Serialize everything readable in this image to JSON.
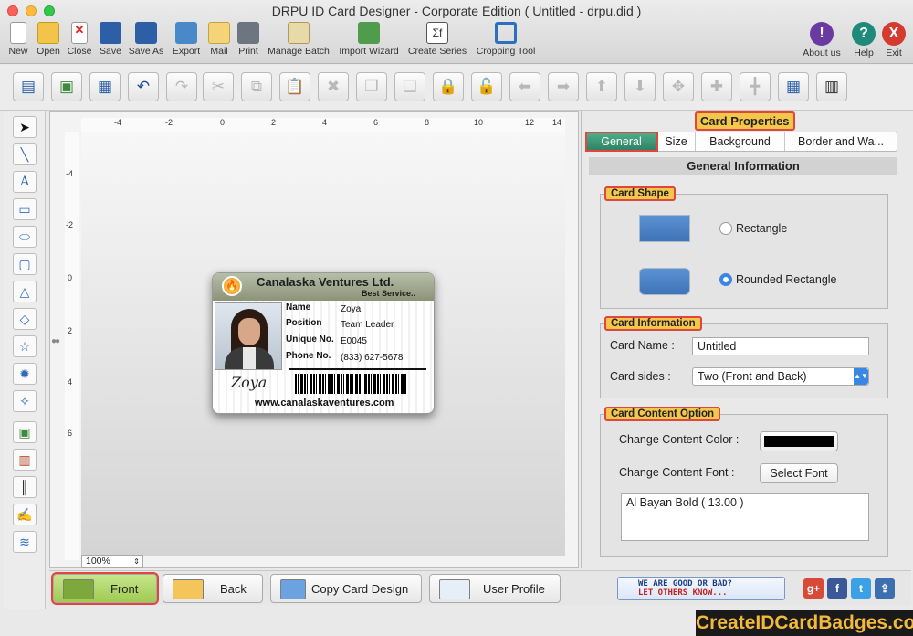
{
  "window": {
    "title": "DRPU ID Card Designer - Corporate Edition ( Untitled - drpu.did )"
  },
  "toolbar": {
    "items": [
      {
        "label": "New",
        "icon": "new-icon"
      },
      {
        "label": "Open",
        "icon": "open-icon"
      },
      {
        "label": "Close",
        "icon": "close-file-icon"
      },
      {
        "label": "Save",
        "icon": "save-icon"
      },
      {
        "label": "Save As",
        "icon": "save-as-icon"
      },
      {
        "label": "Export",
        "icon": "export-icon"
      },
      {
        "label": "Mail",
        "icon": "mail-icon"
      },
      {
        "label": "Print",
        "icon": "print-icon"
      },
      {
        "label": "Manage Batch",
        "icon": "manage-batch-icon"
      },
      {
        "label": "Import Wizard",
        "icon": "import-wizard-icon"
      },
      {
        "label": "Create Series",
        "icon": "create-series-icon"
      },
      {
        "label": "Cropping Tool",
        "icon": "cropping-tool-icon"
      }
    ],
    "right": [
      {
        "label": "About us",
        "glyph": "!",
        "color": "#6a3aa2"
      },
      {
        "label": "Help",
        "glyph": "?",
        "color": "#1f8a7a"
      },
      {
        "label": "Exit",
        "glyph": "X",
        "color": "#d43a2f"
      }
    ]
  },
  "canvas": {
    "zoom": "100%",
    "ruler_top": [
      "-4",
      "-2",
      "0",
      "2",
      "4",
      "6",
      "8",
      "10",
      "12",
      "14"
    ],
    "ruler_left": [
      "-4",
      "-2",
      "0",
      "2",
      "4",
      "6"
    ]
  },
  "card": {
    "company": "Canalaska Ventures Ltd.",
    "tagline": "Best Service..",
    "fields": [
      {
        "label": "Name",
        "value": "Zoya"
      },
      {
        "label": "Position",
        "value": "Team Leader"
      },
      {
        "label": "Unique No.",
        "value": "E0045"
      },
      {
        "label": "Phone No.",
        "value": "(833) 627-5678"
      }
    ],
    "website": "www.canalaskaventures.com"
  },
  "properties": {
    "title": "Card Properties",
    "tabs": [
      "General",
      "Size",
      "Background",
      "Border and Wa..."
    ],
    "active_tab": "General",
    "section_header": "General Information",
    "card_shape": {
      "title": "Card Shape",
      "options": [
        "Rectangle",
        "Rounded Rectangle"
      ],
      "selected": "Rounded Rectangle"
    },
    "card_information": {
      "title": "Card Information",
      "name_label": "Card Name :",
      "name_value": "Untitled",
      "sides_label": "Card sides :",
      "sides_value": "Two (Front and Back)"
    },
    "content_option": {
      "title": "Card Content Option",
      "color_label": "Change Content Color :",
      "color_value": "#000000",
      "font_label": "Change Content Font :",
      "font_button": "Select Font",
      "font_value": "Al Bayan Bold ( 13.00 )"
    }
  },
  "bottom": {
    "front": "Front",
    "back": "Back",
    "copy": "Copy Card Design",
    "profile": "User Profile",
    "feedback_line1": "WE ARE GOOD OR BAD?",
    "feedback_line2": "LET OTHERS KNOW...",
    "brand": "CreateIDCardBadges.com"
  }
}
